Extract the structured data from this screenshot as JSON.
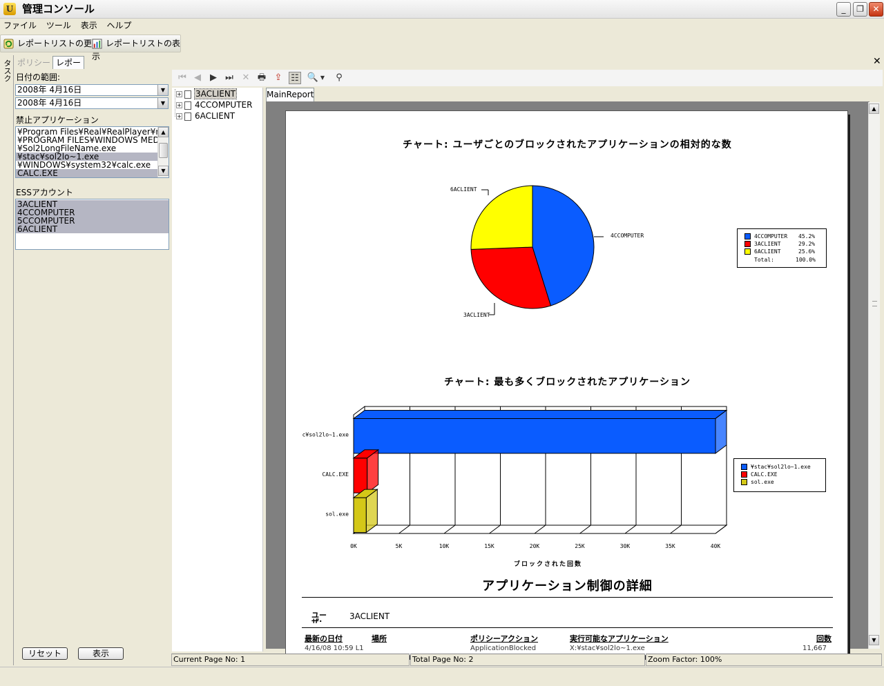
{
  "window": {
    "title": "管理コンソール"
  },
  "menu": [
    "ファイル",
    "ツール",
    "表示",
    "ヘルプ"
  ],
  "toolbar": {
    "refresh_label": "レポートリストの更新",
    "show_label": "レポートリストの表示"
  },
  "task_strip": {
    "label": "タスク"
  },
  "tabs": {
    "policy": "ポリシー",
    "report": "レポート"
  },
  "left": {
    "date_range_label": "日付の範囲:",
    "date_from": "2008年  4月16日",
    "date_to": "2008年  4月16日",
    "blocked_apps_label": "禁止アプリケーション",
    "blocked_apps": [
      "¥Program Files¥Real¥RealPlayer¥realplay",
      "¥PROGRAM FILES¥WINDOWS MEDIA PLAYER",
      "¥Sol2LongFileName.exe",
      "¥stac¥sol2lo~1.exe",
      "¥WINDOWS¥system32¥calc.exe",
      "CALC.EXE"
    ],
    "ess_label": "ESSアカウント",
    "ess_accounts": [
      "3ACLIENT",
      "4CCOMPUTER",
      "5CCOMPUTER",
      "6ACLIENT"
    ],
    "reset_button": "リセット",
    "show_button": "表示"
  },
  "tree": [
    "3ACLIENT",
    "4CCOMPUTER",
    "6ACLIENT"
  ],
  "report_tab": "MainReport",
  "report": {
    "chart1_title": "チャート:  ユーザごとのブロックされたアプリケーションの相対的な数",
    "chart2_title": "チャート:  最も多くブロックされたアプリケーション",
    "pie_labels": {
      "a": "6ACLIENT",
      "b": "4CCOMPUTER",
      "c": "3ACLIENT"
    },
    "legend1_total_label": "Total:",
    "legend1_total_value": "100.0%",
    "bar_axis_label": "ブロックされた回数",
    "detail_title": "アプリケーション制御の詳細",
    "user_label": "ユー ザ:",
    "user_value": "3ACLIENT",
    "columns": [
      "最新の日付",
      "場所",
      "ポリシーアクション",
      "実行可能なアプリケーション",
      "回数"
    ],
    "partial_row": [
      "4/16/08   10:59 L1",
      "ApplicationBlocked",
      "X:¥stac¥sol2lo~1.exe",
      "11,667"
    ]
  },
  "status": {
    "current_page": "Current Page No: 1",
    "total_page": "Total Page No: 2",
    "zoom": "Zoom Factor: 100%"
  },
  "colors": {
    "blue": "#0a5cff",
    "red": "#ff0000",
    "yellow": "#ffff00",
    "olive": "#d4c818"
  },
  "chart_data": [
    {
      "type": "pie",
      "title": "チャート:  ユーザごとのブロックされたアプリケーションの相対的な数",
      "categories": [
        "4CCOMPUTER",
        "3ACLIENT",
        "6ACLIENT"
      ],
      "values": [
        45.2,
        29.2,
        25.6
      ],
      "value_labels": [
        "45.2%",
        "29.2%",
        "25.6%"
      ],
      "colors": [
        "#0a5cff",
        "#ff0000",
        "#ffff00"
      ],
      "legend": "right"
    },
    {
      "type": "bar",
      "orientation": "horizontal",
      "title": "チャート:  最も多くブロックされたアプリケーション",
      "categories": [
        "c¥sol2lo~1.exe",
        "CALC.EXE",
        "sol.exe"
      ],
      "values": [
        40000,
        1500,
        1400
      ],
      "series_legend": [
        "¥stac¥sol2lo~1.exe",
        "CALC.EXE",
        "sol.exe"
      ],
      "colors": [
        "#0a5cff",
        "#ff0000",
        "#d4c818"
      ],
      "xlabel": "ブロックされた回数",
      "xlim": [
        0,
        40000
      ],
      "ticks": [
        "0K",
        "5K",
        "10K",
        "15K",
        "20K",
        "25K",
        "30K",
        "35K",
        "40K"
      ],
      "legend": "right"
    }
  ]
}
